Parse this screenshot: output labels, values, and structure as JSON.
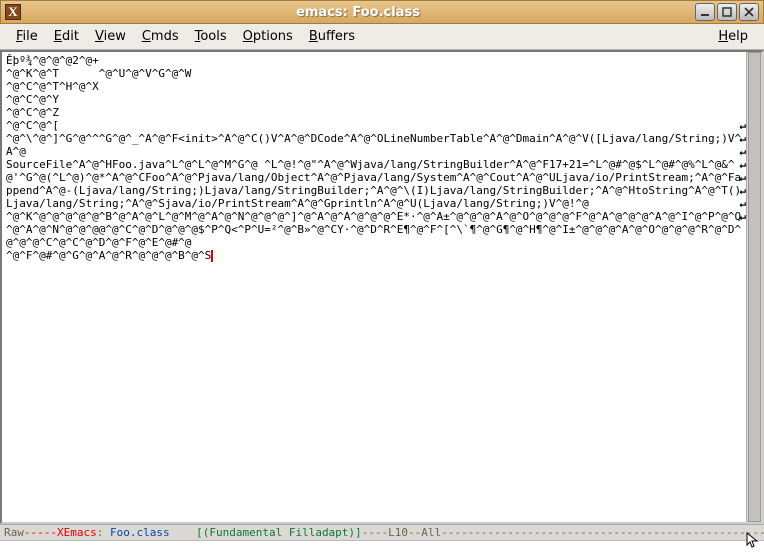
{
  "title": {
    "icon_letter": "X",
    "text": "emacs: Foo.class"
  },
  "menu": {
    "file": "File",
    "edit": "Edit",
    "view": "View",
    "cmds": "Cmds",
    "tools": "Tools",
    "options": "Options",
    "buffers": "Buffers",
    "help": "Help"
  },
  "buffer_lines": [
    "Êþº¾^@^@^@2^@+",
    "^@^K^@^T      ^@^U^@^V^G^@^W",
    "^@^C^@^T^H^@^X",
    "^@^C^@^Y",
    "^@^C^@^Z",
    "^@^C^@^[",
    "^@^\\^@^]^G^@^^^G^@^_^A^@^F<init>^A^@^C()V^A^@^DCode^A^@^OLineNumberTable^A^@^Dmain^A^@^V([Ljava/lang/String;)V^A^@",
    "SourceFile^A^@^HFoo.java^L^@^L^@^M^G^@ ^L^@!^@\"^A^@^Wjava/lang/StringBuilder^A^@^F17+21=^L^@#^@$^L^@#^@%^L^@&^@'^G^@(^L^@)^@*^A^@^CFoo^A^@^Pjava/lang/Object^A^@^Pjava/lang/System^A^@^Cout^A^@^ULjava/io/PrintStream;^A^@^Fappend^A^@-(Ljava/lang/String;)Ljava/lang/StringBuilder;^A^@^\\(I)Ljava/lang/StringBuilder;^A^@^HtoString^A^@^T()Ljava/lang/String;^A^@^Sjava/io/PrintStream^A^@^Gprintln^A^@^U(Ljava/lang/String;)V^@!^@",
    "^@^K^@^@^@^@^@^B^@^A^@^L^@^M^@^A^@^N^@^@^@^]^@^A^@^A^@^@^@^E*·^@^A±^@^@^@^A^@^O^@^@^@^F^@^A^@^@^@^A^@^I^@^P^@^Q^@^A^@^N^@^@^@@^@^C^@^D^@^@^@$^P^Q<^P^U=²^@^B»^@^CY·^@^D^R^E¶^@^F^[^\\`¶^@^G¶^@^H¶^@^I±^@^@^@^A^@^O^@^@^@^R^@^D^@^@^@^C^@^C^@^D^@^F^@^E^@#^@",
    "^@^F^@#^@^G^@^A^@^R^@^@^@^B^@^S"
  ],
  "wrap_rows": [
    5,
    6,
    7,
    8,
    9,
    10,
    11,
    12
  ],
  "mode_line": {
    "prefix": "Raw",
    "dashes1": "-----",
    "editor": "XEmacs",
    "sep": ": ",
    "file": "Foo.class",
    "spaces": "    ",
    "modes": "[(Fundamental Filladapt)]",
    "suffix": "----L10--All----------------------------------------------------------------------"
  }
}
